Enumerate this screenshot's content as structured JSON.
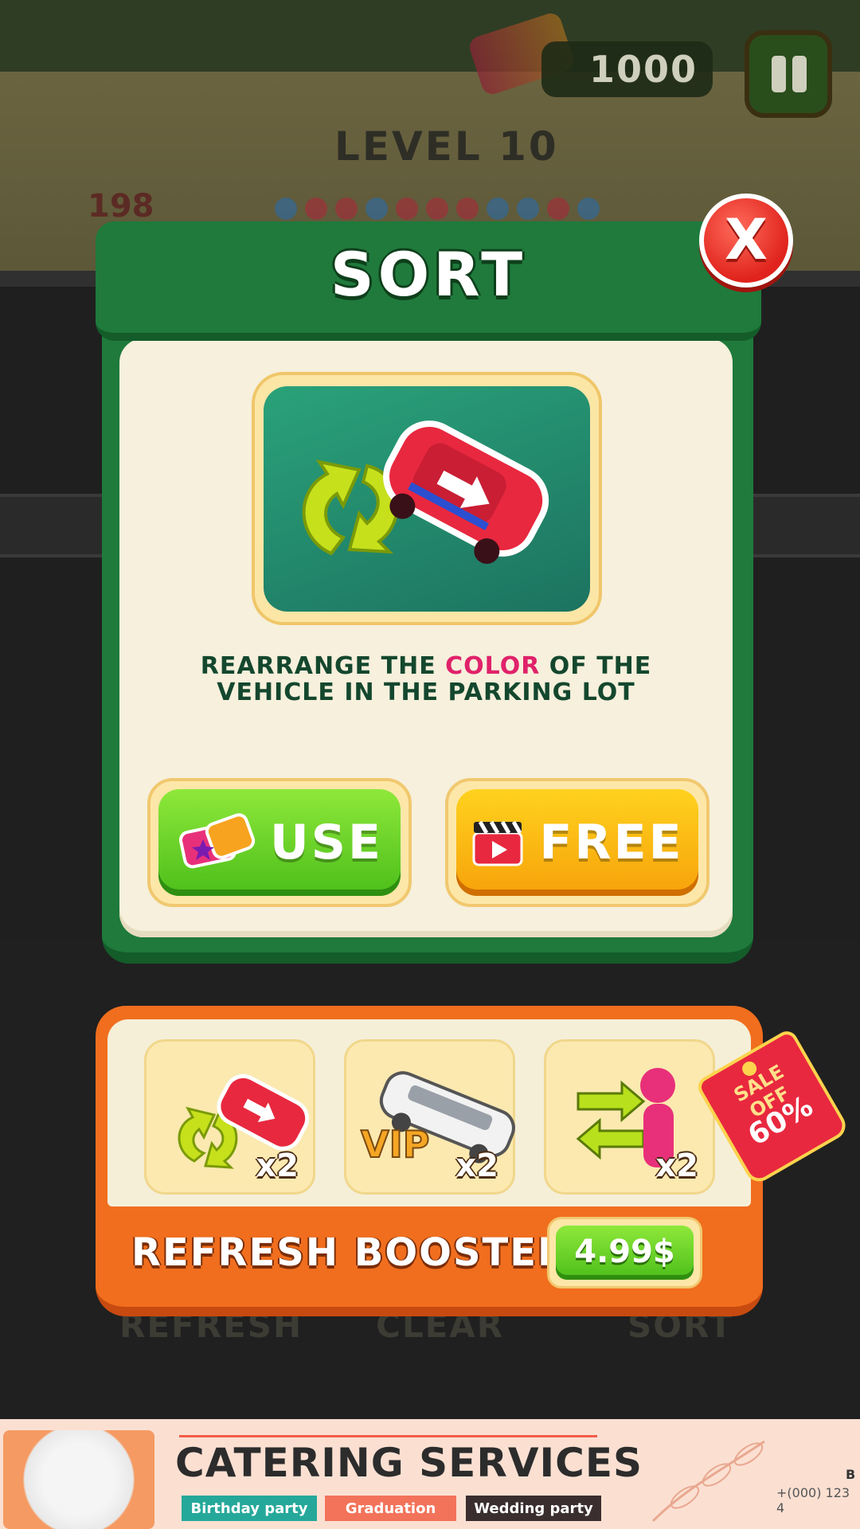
{
  "hud": {
    "coins": "1000",
    "level": "LEVEL 10",
    "counter": "198"
  },
  "background_labels": {
    "refresh": "REFRESH",
    "clear": "CLEAR",
    "sort": "SORT"
  },
  "dialog": {
    "title": "SORT",
    "close_label": "X",
    "description_part1": "REARRANGE THE ",
    "description_accent": "COLOR",
    "description_part2": " OF THE VEHICLE IN THE PARKING LOT",
    "use_label": "USE",
    "free_label": "FREE"
  },
  "offer": {
    "items": [
      {
        "icon": "sort-car-icon",
        "qty": "x2"
      },
      {
        "icon": "vip-limo-icon",
        "qty": "x2"
      },
      {
        "icon": "swap-person-icon",
        "qty": "x2"
      }
    ],
    "label": "REFRESH BOOSTER",
    "price": "4.99$",
    "sale_line1": "SALE",
    "sale_line2": "OFF",
    "sale_pct": "60%"
  },
  "ad": {
    "title": "CATERING SERVICES",
    "tags": [
      "Birthday party",
      "Graduation",
      "Wedding party"
    ],
    "phone": "+(000) 123 4",
    "corner": "B"
  },
  "colors": {
    "dialog_green": "#1f7a3c",
    "use_green": "#4cbe1a",
    "free_orange": "#f7a20a",
    "offer_orange": "#f06e1e",
    "accent_pink": "#e0226a",
    "close_red": "#e0231c"
  }
}
